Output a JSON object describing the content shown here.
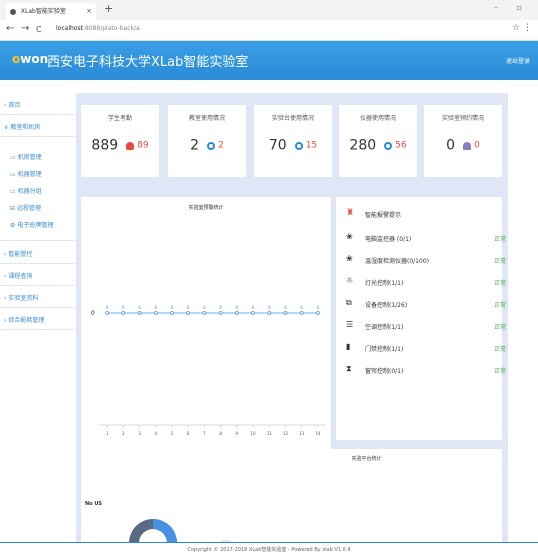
{
  "browser": {
    "tab_title": "XLab智能实验室",
    "url_host": "localhost",
    "url_path": ":8088/plato-back/a",
    "tab_close": "×",
    "new_tab": "+",
    "back": "←",
    "forward": "→",
    "reload": "C",
    "star": "☆",
    "menu": "⋮"
  },
  "header": {
    "logo": "owon",
    "title": "西安电子科技大学XLab智能实验室",
    "logout": "退出登录"
  },
  "sidebar": {
    "items": [
      {
        "label": "首页",
        "icon": "›"
      },
      {
        "label": "教室和机房",
        "icon": "∨"
      },
      {
        "label": "机房管理",
        "icon": "▭"
      },
      {
        "label": "机器管理",
        "icon": "▭"
      },
      {
        "label": "机器分组",
        "icon": "▭"
      },
      {
        "label": "远程管理",
        "icon": "⊟"
      },
      {
        "label": "电子班牌管理",
        "icon": "⚙"
      },
      {
        "label": "智能管控",
        "icon": "›"
      },
      {
        "label": "课程查询",
        "icon": "›"
      },
      {
        "label": "实验室资料",
        "icon": "›"
      },
      {
        "label": "综合能耗管理",
        "icon": "›"
      }
    ]
  },
  "stats": [
    {
      "title": "学生考勤",
      "main": "889",
      "sub": "89",
      "sub_color": "#e74c3c",
      "icon": "person-alert-icon"
    },
    {
      "title": "教室使用情况",
      "main": "2",
      "sub": "2",
      "sub_color": "#e74c3c",
      "icon": "clock-icon"
    },
    {
      "title": "实验台使用情况",
      "main": "70",
      "sub": "15",
      "sub_color": "#e74c3c",
      "icon": "clock-icon"
    },
    {
      "title": "仪器使用情况",
      "main": "280",
      "sub": "56",
      "sub_color": "#e74c3c",
      "icon": "clock-icon"
    },
    {
      "title": "实验室预约情况",
      "main": "0",
      "sub": "0",
      "sub_color": "#e74c3c",
      "icon": "bell-icon"
    }
  ],
  "chart_data": {
    "type": "line",
    "title": "实验室预警统计",
    "x": [
      1,
      2,
      3,
      4,
      5,
      6,
      7,
      8,
      9,
      10,
      11,
      12,
      13,
      14
    ],
    "series": [
      {
        "values": [
          0,
          0,
          0,
          0,
          0,
          0,
          0,
          0,
          0,
          0,
          0,
          0,
          0,
          0
        ]
      }
    ],
    "ytick": "0"
  },
  "status_panel": {
    "header": "智能报警提示",
    "rows": [
      {
        "label": "电脑监控器 (0/1)",
        "status": "正常",
        "icon": "fan-icon"
      },
      {
        "label": "温湿度检测仪器(0/100)",
        "status": "正常",
        "icon": "fan-icon"
      },
      {
        "label": "灯光控制(1/1)",
        "status": "正常",
        "icon": "bulb-icon"
      },
      {
        "label": "设备控制(1/26)",
        "status": "正常",
        "icon": "socket-icon"
      },
      {
        "label": "空调控制(1/1)",
        "status": "正常",
        "icon": "ac-icon"
      },
      {
        "label": "门禁控制(1/1)",
        "status": "正常",
        "icon": "door-icon"
      },
      {
        "label": "窗帘控制(0/1)",
        "status": "正常",
        "icon": "curtain-icon"
      }
    ]
  },
  "bottom": {
    "left_label": "No US",
    "right_title": "实验平台统计"
  },
  "footer": "Copyright © 2017-2018 XLab智能实验室 - Powered By xlab V1.0.4"
}
